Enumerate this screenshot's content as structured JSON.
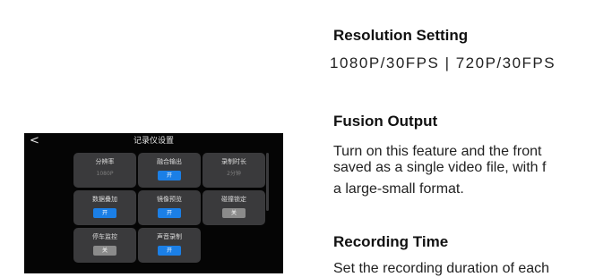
{
  "device": {
    "back_glyph": "<",
    "title": "记录仪设置",
    "tiles": {
      "resolution": {
        "label": "分辨率",
        "value": "1080P"
      },
      "fusion_output": {
        "label": "融合输出",
        "toggle": "开"
      },
      "record_duration": {
        "label": "录制时长",
        "value": "2分钟"
      },
      "data_overlay": {
        "label": "数据叠加",
        "toggle": "开"
      },
      "mirror_preview": {
        "label": "镜像预览",
        "toggle": "开"
      },
      "collision_lock": {
        "label": "碰撞锁定",
        "toggle": "关"
      },
      "parking_monitor": {
        "label": "停车监控",
        "toggle": "关"
      },
      "audio_record": {
        "label": "声音录制",
        "toggle": "开"
      }
    },
    "colors": {
      "toggle_on": "#1b7fe6",
      "toggle_off": "#8b8b8b",
      "tile": "#3a3a3c"
    }
  },
  "sections": {
    "resolution": {
      "heading": "Resolution Setting",
      "options": "1080P/30FPS | 720P/30FPS"
    },
    "fusion": {
      "heading": "Fusion Output",
      "lines": [
        "Turn on this feature and the front",
        "saved as a single video file, with f",
        "a large-small format."
      ]
    },
    "recording": {
      "heading": "Recording Time",
      "line": "Set the recording duration of each"
    }
  }
}
